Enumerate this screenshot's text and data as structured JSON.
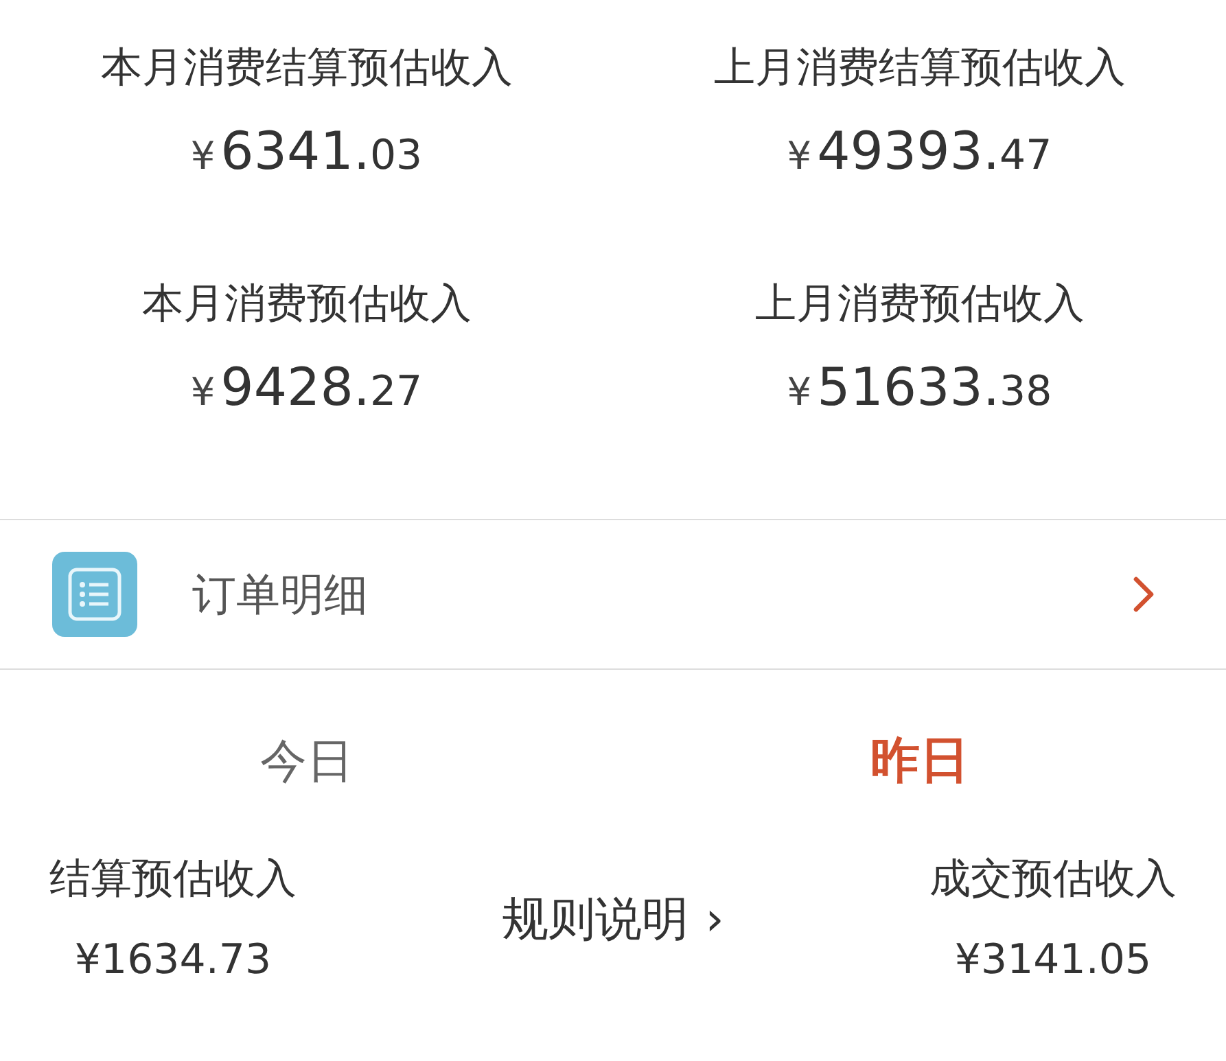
{
  "summary": [
    {
      "label": "本月消费结算预估收入",
      "currency": "¥",
      "integer": "6341.",
      "decimal": "03"
    },
    {
      "label": "上月消费结算预估收入",
      "currency": "¥",
      "integer": "49393.",
      "decimal": "47"
    },
    {
      "label": "本月消费预估收入",
      "currency": "¥",
      "integer": "9428.",
      "decimal": "27"
    },
    {
      "label": "上月消费预估收入",
      "currency": "¥",
      "integer": "51633.",
      "decimal": "38"
    }
  ],
  "order_detail": {
    "label": "订单明细"
  },
  "tabs": [
    {
      "label": "今日",
      "selected": false
    },
    {
      "label": "昨日",
      "selected": true
    }
  ],
  "daily": {
    "left": {
      "label": "结算预估收入",
      "amount": "¥1634.73"
    },
    "rules": {
      "label": "规则说明",
      "arrow": "›"
    },
    "right": {
      "label": "成交预估收入",
      "amount": "¥3141.05"
    }
  }
}
